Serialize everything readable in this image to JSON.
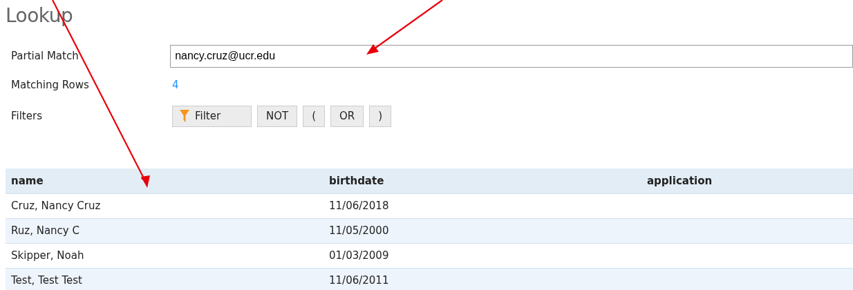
{
  "page": {
    "title": "Lookup"
  },
  "form": {
    "partial_match": {
      "label": "Partial Match",
      "value": "nancy.cruz@ucr.edu"
    },
    "matching_rows": {
      "label": "Matching Rows",
      "value": "4"
    },
    "filters": {
      "label": "Filters",
      "buttons": [
        {
          "label": "Filter",
          "kind": "filter"
        },
        {
          "label": "NOT",
          "kind": "plain"
        },
        {
          "label": "(",
          "kind": "plain"
        },
        {
          "label": "OR",
          "kind": "plain"
        },
        {
          "label": ")",
          "kind": "plain"
        }
      ]
    }
  },
  "table": {
    "columns": [
      "name",
      "birthdate",
      "application"
    ],
    "rows": [
      [
        "Cruz, Nancy Cruz",
        "11/06/2018",
        ""
      ],
      [
        "Ruz, Nancy C",
        "11/05/2000",
        ""
      ],
      [
        "Skipper, Noah",
        "01/03/2009",
        ""
      ],
      [
        "Test, Test Test",
        "11/06/2011",
        ""
      ]
    ]
  }
}
